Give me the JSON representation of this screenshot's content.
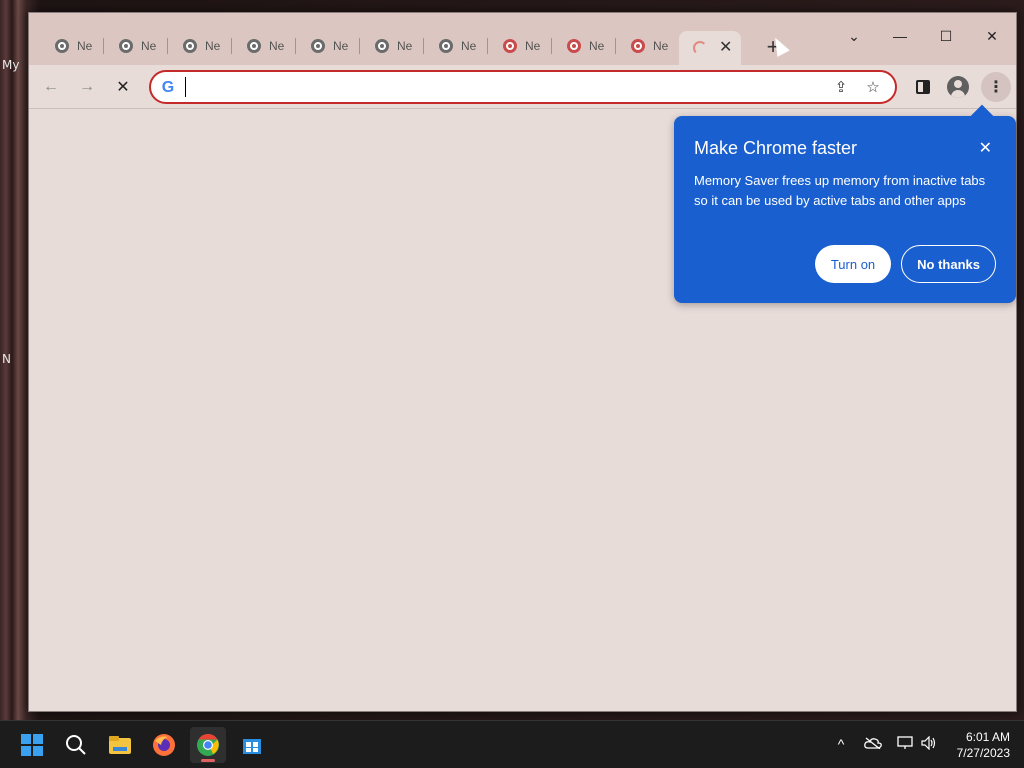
{
  "desktop": {
    "label_top": "My",
    "label_mid": "N"
  },
  "tabs": {
    "items": [
      {
        "label": "Ne"
      },
      {
        "label": "Ne"
      },
      {
        "label": "Ne"
      },
      {
        "label": "Ne"
      },
      {
        "label": "Ne"
      },
      {
        "label": "Ne"
      },
      {
        "label": "Ne"
      },
      {
        "label": "Ne"
      },
      {
        "label": "Ne"
      },
      {
        "label": "Ne"
      }
    ],
    "active_close": "✕",
    "new_tab": "+"
  },
  "window_controls": {
    "tab_search": "⌄",
    "minimize": "—",
    "maximize": "☐",
    "close": "✕"
  },
  "toolbar": {
    "back": "←",
    "forward": "→",
    "stop": "✕",
    "omnibox_value": "",
    "share": "⇪",
    "bookmark": "☆",
    "menu": "⋮",
    "google_g": "G"
  },
  "bubble": {
    "title": "Make Chrome faster",
    "body": "Memory Saver frees up memory from inactive tabs so it can be used by active tabs and other apps",
    "close": "✕",
    "primary": "Turn on",
    "secondary": "No thanks"
  },
  "taskbar": {
    "time": "6:01 AM",
    "date": "7/27/2023",
    "chevron": "^",
    "volume": "🔊"
  },
  "colors": {
    "accent": "#1a5fcf",
    "omnibox_border": "#c52a2a"
  }
}
